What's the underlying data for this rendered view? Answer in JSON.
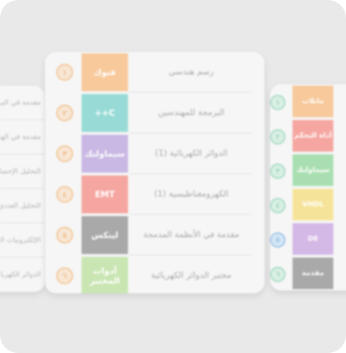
{
  "main": {
    "items": [
      {
        "num": "١",
        "tile": "فنوك",
        "title": "رسم هندسي",
        "color": "#f7c99b"
      },
      {
        "num": "٢",
        "tile": "C++",
        "title": "البرمجة للمهندسين",
        "color": "#98dbd6"
      },
      {
        "num": "٣",
        "tile": "سيماولنك",
        "title": "الدوائر الكهربائية (1)",
        "color": "#c9b8e3"
      },
      {
        "num": "٤",
        "tile": "EMT",
        "title": "الكهرومغناطيسية (1)",
        "color": "#f5a6a0"
      },
      {
        "num": "٥",
        "tile": "لينكس",
        "title": "مقدمة في الأنظمة المدمجة",
        "color": "#a9a9a9"
      },
      {
        "num": "٦",
        "tile": "أدوات المختبر",
        "title": "مختبر الدوائر الكهربائية",
        "color": "#c9e5b2"
      }
    ]
  },
  "left": {
    "items": [
      {
        "text": "مقدمة في البرمجة"
      },
      {
        "text": "مقدمة في الهندسة"
      },
      {
        "text": "التحليل الإحصائي"
      },
      {
        "text": "التحليل العددي"
      },
      {
        "text": "الإلكترونيات التناظرية"
      },
      {
        "text": "الدوائر الكهربائية"
      }
    ]
  },
  "right": {
    "items": [
      {
        "num": "١",
        "tile": "ماتلاب",
        "color": "#f7c99b",
        "blue": false
      },
      {
        "num": "٢",
        "tile": "أداة التحكم",
        "color": "#f5a6a0",
        "blue": false
      },
      {
        "num": "٣",
        "tile": "سيماولنك",
        "color": "#a9dfb0",
        "blue": false
      },
      {
        "num": "٤",
        "tile": "VHDL",
        "color": "#f6e39a",
        "blue": false
      },
      {
        "num": "٥",
        "tile": "DE",
        "color": "#d4b8e6",
        "blue": true
      },
      {
        "num": "٦",
        "tile": "مقدمة",
        "color": "#a9a9a9",
        "blue": false
      }
    ]
  }
}
